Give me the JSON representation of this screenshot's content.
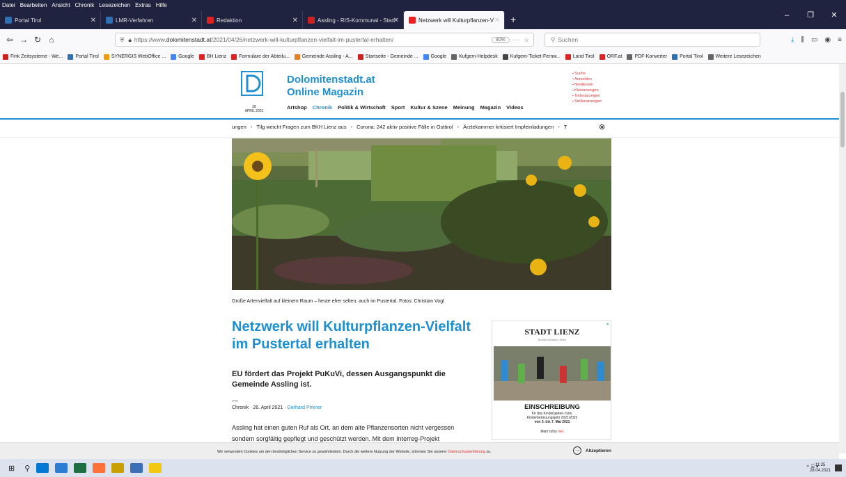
{
  "menubar": [
    "Datei",
    "Bearbeiten",
    "Ansicht",
    "Chronik",
    "Lesezeichen",
    "Extras",
    "Hilfe"
  ],
  "tabs": [
    {
      "label": "Portal Tirol",
      "color": "#2f6fb3",
      "active": false
    },
    {
      "label": "LMR-Verfahren",
      "color": "#2f6fb3",
      "active": false
    },
    {
      "label": "Redaktion",
      "color": "#d22",
      "active": false
    },
    {
      "label": "Assling - RIS-Kommunal - Start",
      "color": "#c22",
      "active": false
    },
    {
      "label": "Netzwerk will Kulturpflanzen-V",
      "color": "#e22",
      "active": true
    }
  ],
  "nav": {
    "url_prefix": "https://www.",
    "url_domain": "dolomitenstadt.at",
    "url_path": "/2021/04/26/netzwerk-will-kulturpflanzen-vielfalt-im-pustertal-erhalten/",
    "zoom": "80%",
    "search_placeholder": "Suchen"
  },
  "bookmarks": [
    {
      "label": "Fink Zeitsysteme - We...",
      "color": "#c22"
    },
    {
      "label": "Portal Tirol",
      "color": "#2f6fb3"
    },
    {
      "label": "SYNERGIS WebOffice ...",
      "color": "#f39c12"
    },
    {
      "label": "Google",
      "color": "#4285f4"
    },
    {
      "label": "BH Lienz",
      "color": "#d22"
    },
    {
      "label": "Formulare der Abteilu...",
      "color": "#d22"
    },
    {
      "label": "Gemeinde Assling - A...",
      "color": "#e67e22"
    },
    {
      "label": "Startseite - Gemeinde ...",
      "color": "#c22"
    },
    {
      "label": "Google",
      "color": "#4285f4"
    },
    {
      "label": "Kufgem-Helpdesk",
      "color": "#666"
    },
    {
      "label": "Kufgem-Ticket-Fernw...",
      "color": "#444"
    },
    {
      "label": "Land Tirol",
      "color": "#d22"
    },
    {
      "label": "ORF.at",
      "color": "#d22"
    },
    {
      "label": "PDF-Konverter",
      "color": "#666"
    },
    {
      "label": "Portal Tirol",
      "color": "#2f6fb3"
    },
    {
      "label": "Weitere Lesezeichen",
      "color": "#666"
    }
  ],
  "site": {
    "brand_line1": "Dolomitenstadt.at",
    "brand_line2": "Online Magazin",
    "date_day": "28",
    "date_month": "APRIL 2021",
    "nav": [
      "Artshop",
      "Chronik",
      "Politik & Wirtschaft",
      "Sport",
      "Kultur & Szene",
      "Meinung",
      "Magazin",
      "Videos"
    ],
    "side_links": [
      "Suche",
      "Anmelden",
      "Notdienste",
      "Kleinanzeigen",
      "Todesanzeigen",
      "Stellenanzeigen"
    ],
    "ticker": [
      "ungen",
      "Tilg weicht Fragen zum BKH Lienz aus",
      "Corona: 242 aktiv positive Fälle in Osttirol",
      "Ärztekammer kritisiert Impfeinladungen",
      "T"
    ]
  },
  "article": {
    "caption": "Große Artenvielfalt auf kleinem Raum – heute eher selten, auch im Pustertal. Fotos: Christian Vogl",
    "title": "Netzwerk will Kulturpflanzen-Vielfalt im Pustertal erhalten",
    "lead": "EU fördert das Projekt PuKuVi, dessen Ausgangspunkt die Gemeinde Assling ist.",
    "dash": "—",
    "meta_prefix": "Chronik · 26. April 2021 · ",
    "author": "Gerhard Pirkner",
    "body": "Assling hat einen guten Ruf als Ort, an dem alte Pflanzensorten nicht vergessen sondern sorgfältig gepflegt und geschützt werden. Mit dem Interreg-Projekt"
  },
  "ad": {
    "logo": "STADT LIENZ",
    "sub": "Modell Schöner Leben",
    "headline": "EINSCHREIBUNG",
    "line1": "für das Kindergarten- bzw.",
    "line2": "Kinderbetreuungsjahr 2021/2022",
    "line3": "von 3. bis 7. Mai 2021",
    "more": "Mehr Infos ",
    "more_link": "hier"
  },
  "cookie": {
    "msg": "Wir verwenden Cookies um den bestmöglichen Service zu gewährleisten. Durch die weitere Nutzung der Website, stimmen Sie unserer ",
    "link": "Datenschutzerklärung",
    "msg_end": " zu.",
    "accept": "Akzeptieren"
  },
  "taskbar": {
    "time": "11:25",
    "date": "28.04.2021",
    "apps": [
      "#0078d4",
      "#2b7cd3",
      "#1d6f42",
      "#ff7139",
      "#c8a000",
      "#3b6fb6",
      "#f2c811"
    ]
  }
}
